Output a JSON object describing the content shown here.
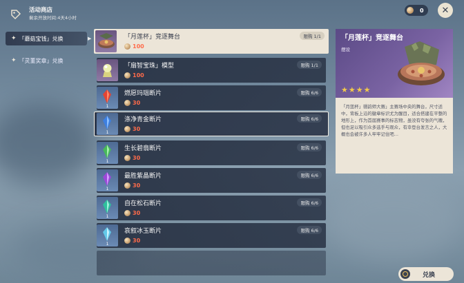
{
  "header": {
    "title": "活动商店",
    "subtitle": "剩余开放时间:4天4小时",
    "currency_count": "0",
    "close_icon": "close-icon",
    "shop_icon": "shop-tag-icon"
  },
  "tabs": [
    {
      "label": "「蘑菇宝钱」兑换",
      "active": true
    },
    {
      "label": "「灵董奖章」兑换",
      "active": false
    }
  ],
  "items": [
    {
      "name": "「月莲杯」竞逐舞台",
      "price": "100",
      "limit": "限购 1/1",
      "qty": "",
      "color": "#b94d3c"
    },
    {
      "name": "「扇智宝珠」模型",
      "price": "100",
      "limit": "限购 1/1",
      "qty": "",
      "color": "#e8e39a"
    },
    {
      "name": "燃愿玛瑙断片",
      "price": "30",
      "limit": "限购 6/6",
      "qty": "1",
      "color": "#e24434"
    },
    {
      "name": "涤净青金断片",
      "price": "30",
      "limit": "限购 6/6",
      "qty": "1",
      "color": "#3d7fe0"
    },
    {
      "name": "生长碧翡断片",
      "price": "30",
      "limit": "限购 6/6",
      "qty": "1",
      "color": "#48b85a"
    },
    {
      "name": "最胜紫晶断片",
      "price": "30",
      "limit": "限购 6/6",
      "qty": "1",
      "color": "#9b48d8"
    },
    {
      "name": "自在松石断片",
      "price": "30",
      "limit": "限购 6/6",
      "qty": "1",
      "color": "#2fbf9d"
    },
    {
      "name": "哀叙冰玉断片",
      "price": "30",
      "limit": "限购 6/6",
      "qty": "1",
      "color": "#63c8e8"
    }
  ],
  "detail": {
    "title": "「月莲杯」竞逐舞台",
    "type": "摆设",
    "stars": "★★★★",
    "description": "「月莲杯」辑韵师大赛」主赛场中央的舞台，尺寸适中，背板上沿的徽章标识尤为醒目，适合搭建在平整的地形上，作为首届赛事的标志物，虽没有夸张的气魄，但也足以吸引众多选手与观众，有幸登台发言之人，大概也会被许多人牢牢记住吧…"
  },
  "exchange_button": {
    "label": "兑换"
  }
}
